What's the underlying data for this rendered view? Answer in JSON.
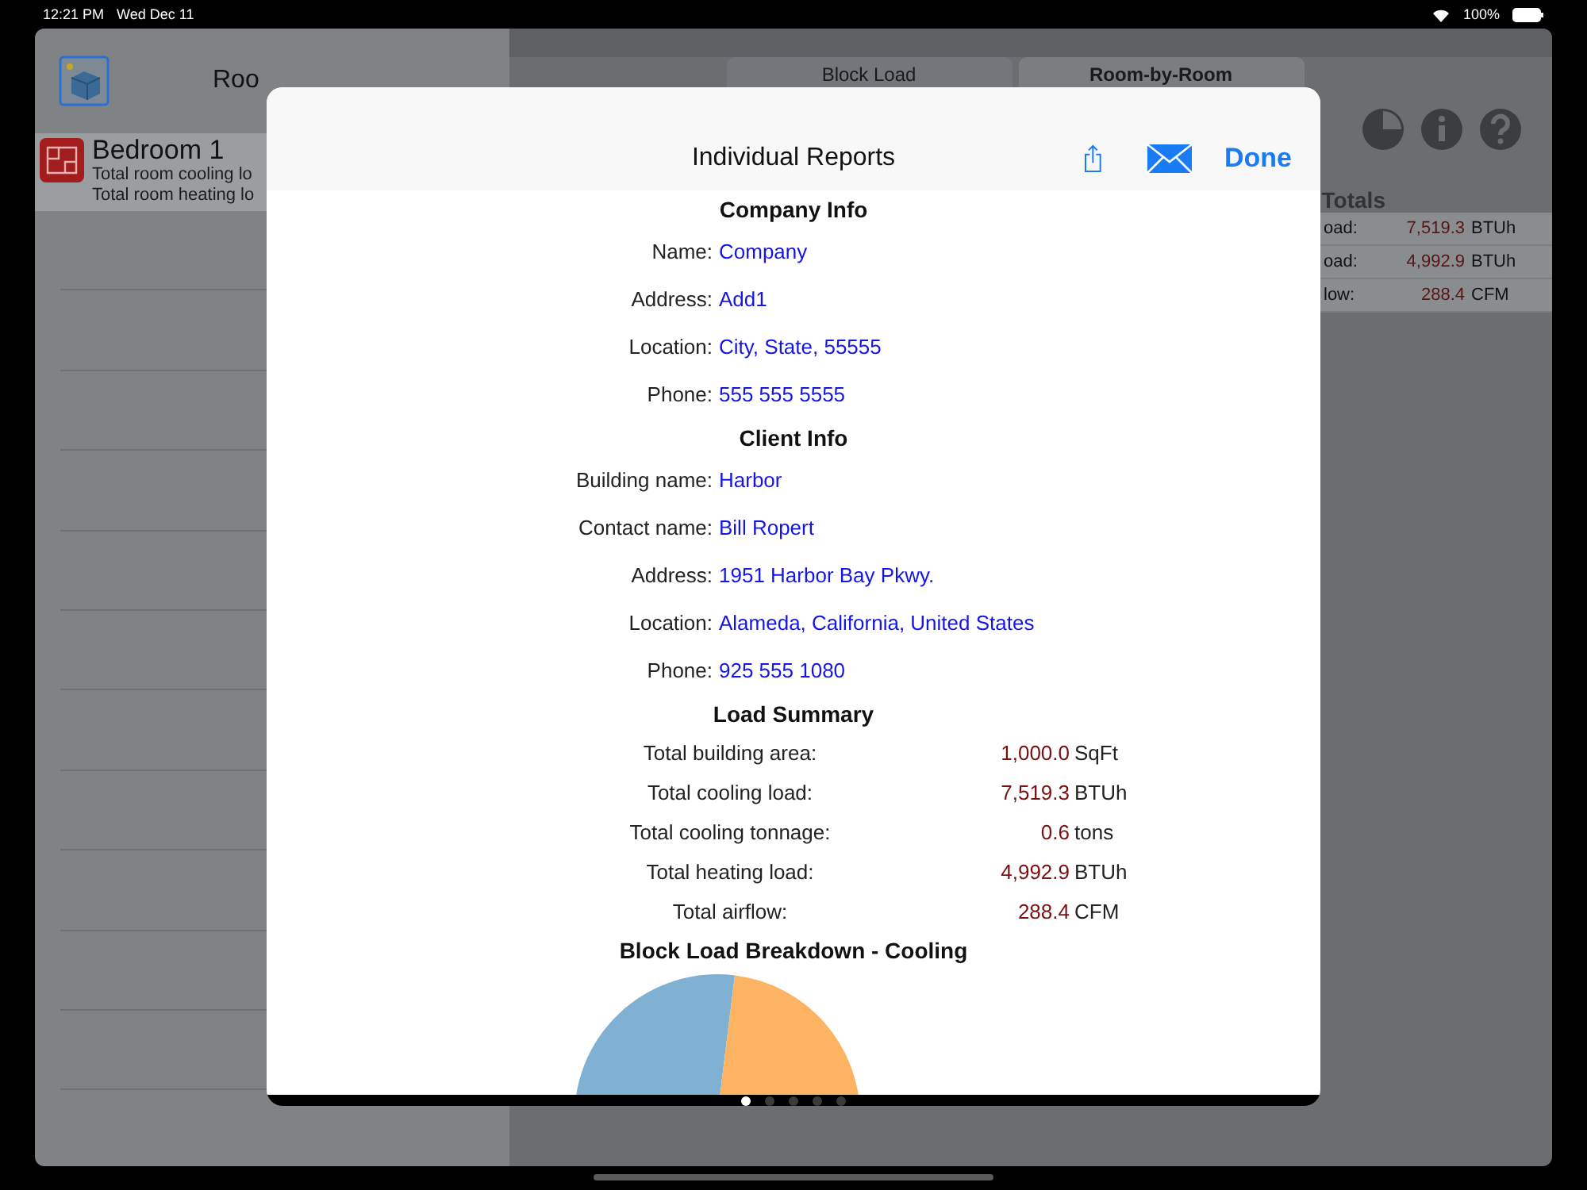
{
  "status_bar": {
    "time": "12:21 PM",
    "date": "Wed Dec 11",
    "battery": "100%"
  },
  "room_list": {
    "title": "Roo",
    "rooms": [
      {
        "name": "Bedroom 1",
        "cooling": "Total room cooling lo",
        "heating": "Total room heating lo",
        "selected": true
      }
    ]
  },
  "mode_tabs": [
    {
      "label": "Block Load",
      "selected": false
    },
    {
      "label": "Room-by-Room",
      "selected": true
    }
  ],
  "totals": {
    "title": "Totals",
    "rows": [
      {
        "label": "oad:",
        "value": "7,519.3",
        "unit": "BTUh"
      },
      {
        "label": "oad:",
        "value": "4,992.9",
        "unit": "BTUh"
      },
      {
        "label": "low:",
        "value": "288.4",
        "unit": "CFM"
      }
    ]
  },
  "dialog": {
    "title": "Individual Reports",
    "done": "Done",
    "sections": [
      {
        "kind": "info",
        "title": "Company Info",
        "rows": [
          {
            "label": "Name:",
            "value": "Company"
          },
          {
            "label": "Address:",
            "value": "Add1"
          },
          {
            "label": "Location:",
            "value": "City, State, 55555"
          },
          {
            "label": "Phone:",
            "value": "555 555 5555"
          }
        ]
      },
      {
        "kind": "info",
        "title": "Client Info",
        "rows": [
          {
            "label": "Building name:",
            "value": "Harbor"
          },
          {
            "label": "Contact name:",
            "value": "Bill Ropert"
          },
          {
            "label": "Address:",
            "value": "1951 Harbor Bay Pkwy."
          },
          {
            "label": "Location:",
            "value": "Alameda, California, United States"
          },
          {
            "label": "Phone:",
            "value": "925 555 1080"
          }
        ]
      },
      {
        "kind": "summary",
        "title": "Load Summary",
        "rows": [
          {
            "label": "Total building area:",
            "value": "1,000.0",
            "unit": "SqFt"
          },
          {
            "label": "Total cooling load:",
            "value": "7,519.3",
            "unit": "BTUh"
          },
          {
            "label": "Total cooling tonnage:",
            "value": "0.6",
            "unit": "tons"
          },
          {
            "label": "Total heating load:",
            "value": "4,992.9",
            "unit": "BTUh"
          },
          {
            "label": "Total airflow:",
            "value": "288.4",
            "unit": "CFM"
          }
        ]
      },
      {
        "kind": "pie",
        "title": "Block Load Breakdown - Cooling"
      }
    ],
    "pages": [
      {
        "selected": true
      },
      {
        "selected": false
      },
      {
        "selected": false
      },
      {
        "selected": false
      },
      {
        "selected": false
      }
    ]
  }
}
